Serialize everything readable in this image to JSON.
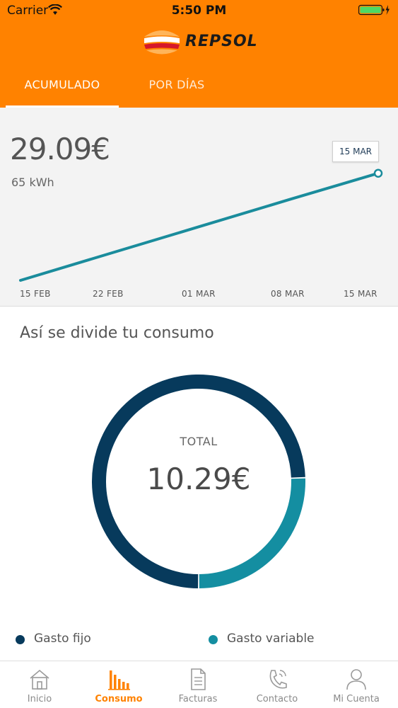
{
  "status_bar": {
    "carrier": "Carrier",
    "time": "5:50 PM"
  },
  "brand": {
    "name": "REPSOL"
  },
  "tabs": [
    {
      "label": "ACUMULADO",
      "active": true
    },
    {
      "label": "POR DÍAS",
      "active": false
    }
  ],
  "summary": {
    "amount": "29.09€",
    "energy": "65 kWh"
  },
  "tooltip": {
    "label": "15 MAR"
  },
  "chart_data": {
    "type": "line",
    "x": [
      "15 FEB",
      "22 FEB",
      "01 MAR",
      "08 MAR",
      "15 MAR"
    ],
    "series": [
      {
        "values": [
          0,
          7.3,
          14.6,
          21.9,
          29.09
        ]
      }
    ],
    "x_tick_labels": [
      "15 FEB",
      "22 FEB",
      "01 MAR",
      "08 MAR",
      "15 MAR"
    ],
    "ylim": [
      0,
      30
    ],
    "grid": false,
    "highlight": "15 MAR",
    "color": "#1a8c9c"
  },
  "breakdown": {
    "title": "Así se divide tu consumo",
    "total_label": "TOTAL",
    "total_value": "10.29€",
    "chart_data": {
      "type": "pie",
      "categories": [
        "Gasto fijo",
        "Gasto variable"
      ],
      "values": [
        7.66,
        2.63
      ],
      "colors": [
        "#073a5c",
        "#148ea1"
      ]
    },
    "legend": [
      {
        "label": "Gasto fijo",
        "color": "#073a5c"
      },
      {
        "label": "Gasto variable",
        "color": "#148ea1"
      }
    ]
  },
  "nav": [
    {
      "label": "Inicio",
      "icon": "home-icon",
      "active": false
    },
    {
      "label": "Consumo",
      "icon": "bar-chart-icon",
      "active": true
    },
    {
      "label": "Facturas",
      "icon": "document-icon",
      "active": false
    },
    {
      "label": "Contacto",
      "icon": "phone-icon",
      "active": false
    },
    {
      "label": "Mi Cuenta",
      "icon": "user-icon",
      "active": false
    }
  ],
  "colors": {
    "accent": "#ff8200",
    "navy": "#073a5c",
    "teal": "#148ea1"
  }
}
